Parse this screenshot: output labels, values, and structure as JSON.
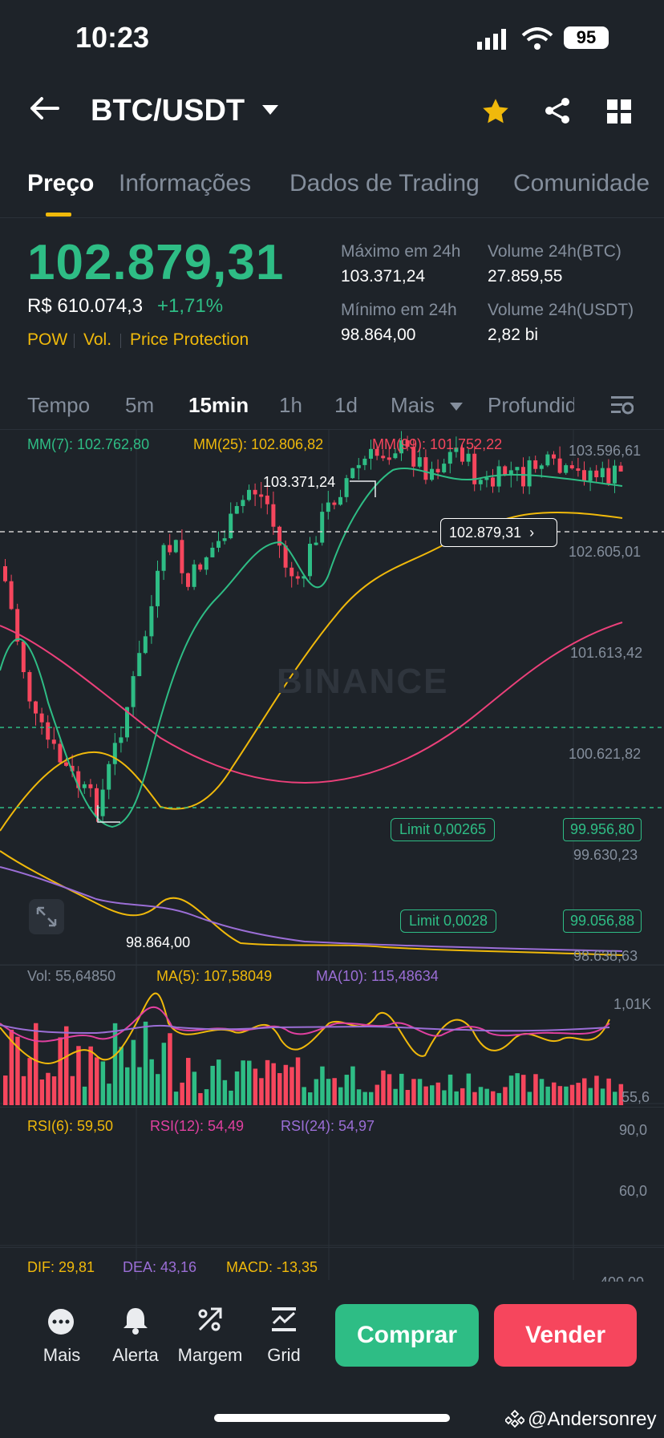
{
  "status": {
    "time": "10:23",
    "battery": "95"
  },
  "header": {
    "pair": "BTC/USDT"
  },
  "tabs": [
    "Preço",
    "Informações",
    "Dados de Trading",
    "Comunidade"
  ],
  "price": {
    "last": "102.879,31",
    "fiat": "R$ 610.074,3",
    "change": "+1,71%"
  },
  "tags": [
    "POW",
    "Vol.",
    "Price Protection"
  ],
  "stats": {
    "high_label": "Máximo em 24h",
    "high": "103.371,24",
    "low_label": "Mínimo em 24h",
    "low": "98.864,00",
    "vol_btc_label": "Volume 24h(BTC)",
    "vol_btc": "27.859,55",
    "vol_usdt_label": "Volume 24h(USDT)",
    "vol_usdt": "2,82 bi"
  },
  "intervals": [
    "Tempo",
    "5m",
    "15min",
    "1h",
    "1d",
    "Mais",
    "Profundidade"
  ],
  "chart": {
    "ma7": "MM(7): 102.762,80",
    "ma25": "MM(25): 102.806,82",
    "ma99": "MM(99): 101.752,22",
    "axis": [
      "103.596,61",
      "102.605,01",
      "101.613,42",
      "100.621,82",
      "99.630,23",
      "98.638,63"
    ],
    "high_marker": "103.371,24",
    "low_marker": "98.864,00",
    "current": "102.879,31",
    "limit1_label": "Limit  0,00265",
    "limit1_price": "99.956,80",
    "limit2_label": "Limit  0,0028",
    "limit2_price": "99.056,88",
    "watermark": "BINANCE"
  },
  "volume": {
    "vol": "Vol: 55,64850",
    "ma5": "MA(5): 107,58049",
    "ma10": "MA(10): 115,48634",
    "axis_top": "1,01K",
    "axis_bottom": "55,6"
  },
  "rsi": {
    "r6": "RSI(6): 59,50",
    "r12": "RSI(12): 54,49",
    "r24": "RSI(24): 54,97",
    "axis_top": "90,0",
    "axis_mid": "60,0"
  },
  "macd": {
    "dif": "DIF: 29,81",
    "dea": "DEA: 43,16",
    "macd": "MACD: -13,35",
    "axis": "400,00"
  },
  "bottom": {
    "more": "Mais",
    "alert": "Alerta",
    "margin": "Margem",
    "grid": "Grid",
    "buy": "Comprar",
    "sell": "Vender"
  },
  "watermark_user": "@Andersonrey",
  "colors": {
    "up": "#2ebd85",
    "down": "#f6465d",
    "accent": "#f0b90b",
    "bg": "#1e2329"
  }
}
